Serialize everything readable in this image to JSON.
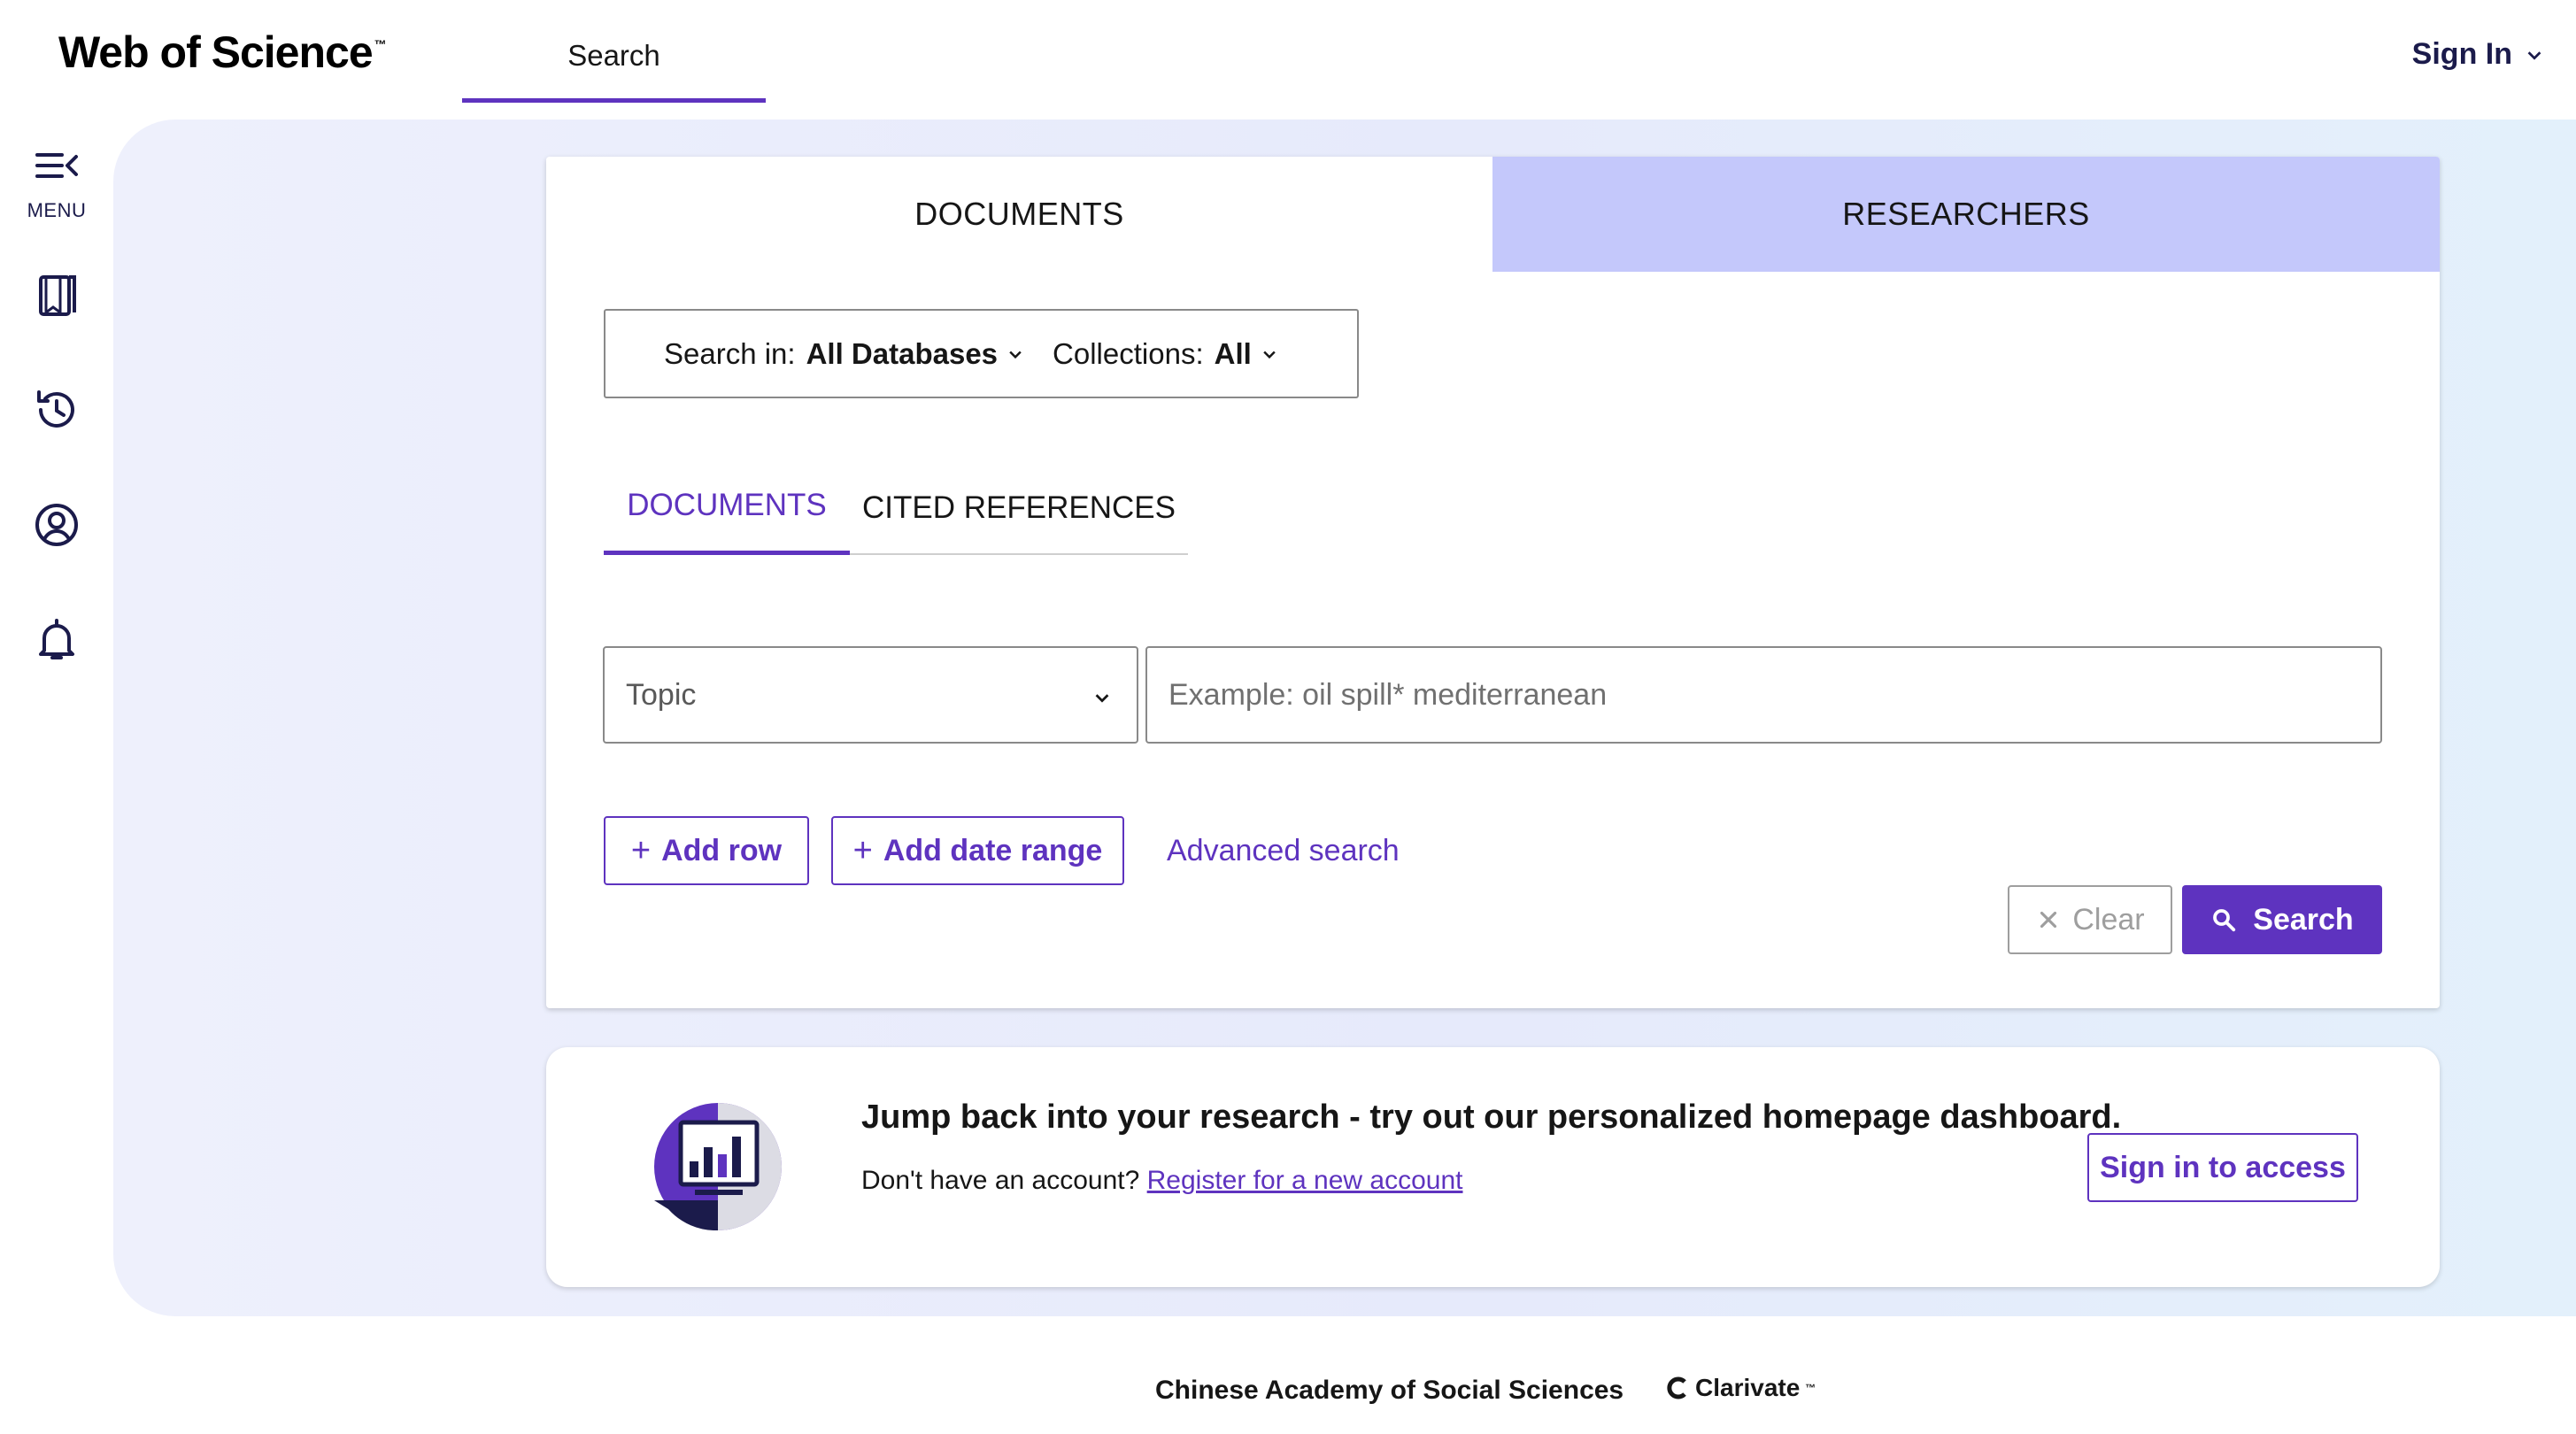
{
  "header": {
    "logo_text": "Web of Science",
    "logo_tm": "™",
    "top_tab": "Search",
    "sign_in": "Sign In"
  },
  "rail": {
    "menu_label": "MENU",
    "icons": [
      "menu-icon",
      "bookmark-icon",
      "history-icon",
      "profile-icon",
      "bell-icon"
    ]
  },
  "search_card": {
    "tabs": [
      "DOCUMENTS",
      "RESEARCHERS"
    ],
    "search_in_label": "Search in:",
    "search_in_value": "All Databases",
    "collections_label": "Collections:",
    "collections_value": "All",
    "subtabs": [
      "DOCUMENTS",
      "CITED REFERENCES"
    ],
    "field_value": "Topic",
    "query_placeholder": "Example: oil spill* mediterranean",
    "add_row": "Add row",
    "add_date_range": "Add date range",
    "advanced_search": "Advanced search",
    "clear": "Clear",
    "search": "Search"
  },
  "promo": {
    "title": "Jump back into your research - try out our personalized homepage dashboard.",
    "sub_text": "Don't have an account?",
    "register_link": "Register for a new account",
    "button": "Sign in to access"
  },
  "footer": {
    "institution": "Chinese Academy of Social Sciences",
    "brand": "Clarivate",
    "brand_tm": "™"
  },
  "colors": {
    "accent": "#5e33bf",
    "tab_inactive_bg": "#c4c8fb",
    "navy": "#1b1b4b"
  }
}
